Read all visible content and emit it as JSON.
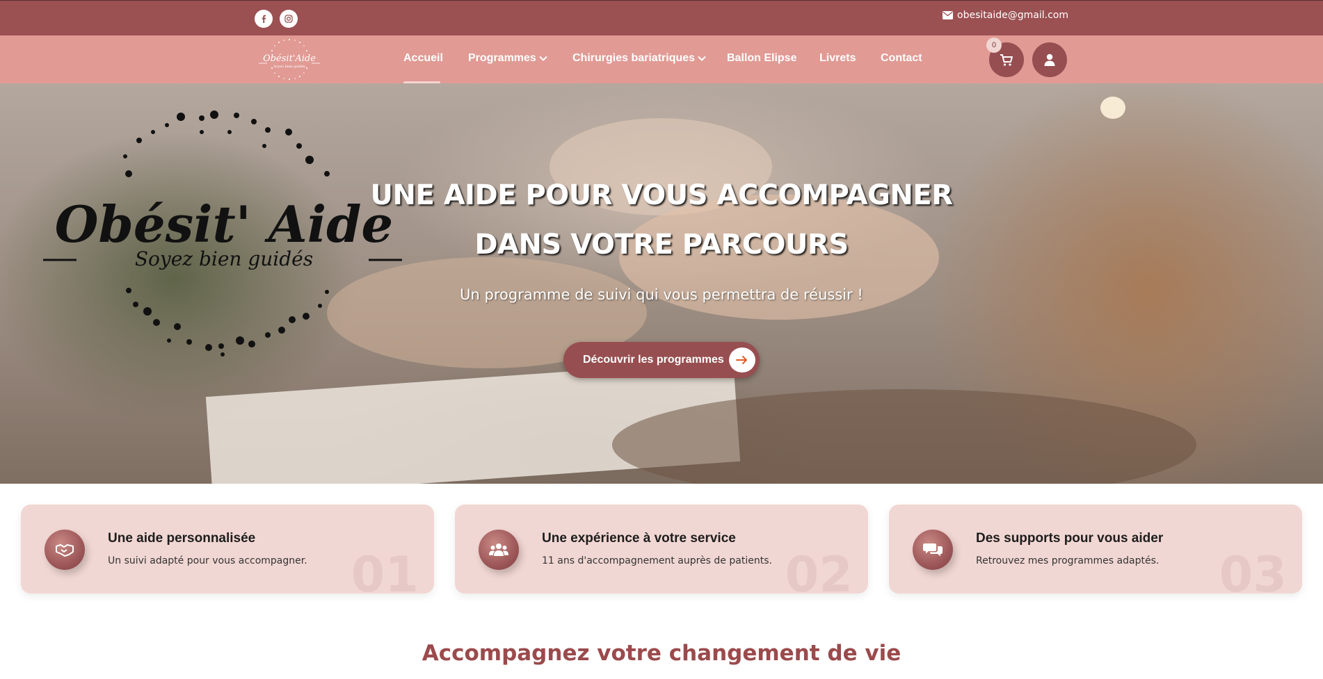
{
  "topbar": {
    "socials": [
      {
        "icon": "facebook-icon"
      },
      {
        "icon": "instagram-icon"
      }
    ],
    "email": "obesitaide@gmail.com"
  },
  "nav": {
    "logo_text": "Obésit'Aide",
    "logo_tagline": "Soyez bien guidés",
    "items": [
      {
        "label": "Accueil",
        "active": true
      },
      {
        "label": "Programmes",
        "dropdown": true
      },
      {
        "label": "Chirurgies bariatriques",
        "dropdown": true
      },
      {
        "label": "Ballon Elipse"
      },
      {
        "label": "Livrets"
      },
      {
        "label": "Contact"
      }
    ],
    "cart_count": "0"
  },
  "hero": {
    "brand": "Obésit' Aide",
    "brand_tagline": "Soyez bien guidés",
    "title_line1": "UNE AIDE POUR VOUS ACCOMPAGNER",
    "title_line2": "DANS VOTRE PARCOURS",
    "subtitle": "Un programme de suivi qui vous permettra de réussir !",
    "cta_label": "Découvrir les programmes"
  },
  "features": [
    {
      "icon": "handshake-icon",
      "title": "Une aide personnalisée",
      "desc": "Un suivi adapté pour vous accompagner.",
      "num": "01"
    },
    {
      "icon": "users-icon",
      "title": "Une expérience à votre service",
      "desc": "11 ans d'accompagnement auprès de patients.",
      "num": "02"
    },
    {
      "icon": "chat-bubbles-icon",
      "title": "Des supports pour vous aider",
      "desc": "Retrouvez mes programmes adaptés.",
      "num": "03"
    }
  ],
  "section": {
    "title": "Accompagnez votre changement de vie"
  },
  "colors": {
    "topbar": "#9b5052",
    "navbar": "#e19a94",
    "accent": "#974e50",
    "card": "#f1d7d3",
    "section_title": "#9b4a4c"
  }
}
